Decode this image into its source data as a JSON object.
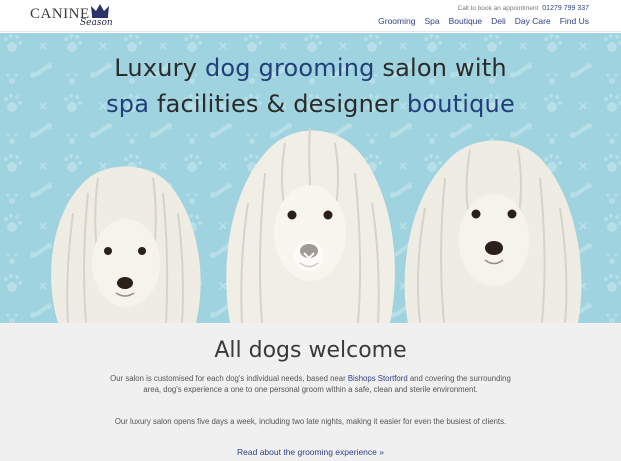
{
  "header": {
    "logo_word": "CANINE",
    "logo_script": "Season",
    "call_label": "Call to book an appointment",
    "phone": "01279 799 337",
    "nav": [
      "Grooming",
      "Spa",
      "Boutique",
      "Deli",
      "Day Care",
      "Find Us"
    ]
  },
  "hero": {
    "line1_a": "Luxury ",
    "line1_accent": "dog grooming",
    "line1_b": " salon with",
    "line2_accent_a": "spa",
    "line2_b": " facilities & designer ",
    "line2_accent_b": "boutique"
  },
  "welcome": {
    "title": "All dogs welcome",
    "p1_a": "Our salon is customised for each dog's individual needs, based near ",
    "p1_link": "Bishops Stortford",
    "p1_b": " and covering the surrounding area, dog's experience a one to one personal groom within a safe, clean and sterile environment.",
    "p2": "Our luxury salon opens five days a week, including two late nights, making it easier for even the busiest of clients.",
    "read_more": "Read about the grooming experience »"
  },
  "colors": {
    "hero_bg": "#9ed3df",
    "accent": "#233f7a",
    "link": "#2f3f8a"
  }
}
